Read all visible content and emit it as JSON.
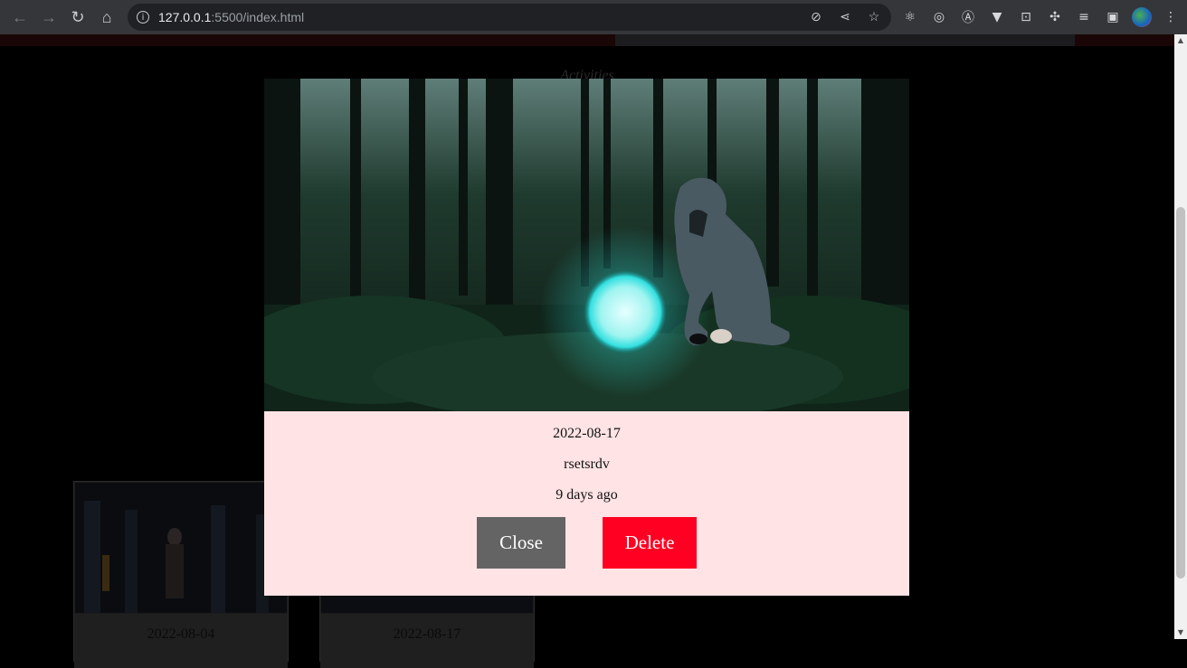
{
  "browser": {
    "url_host": "127.0.0.1",
    "url_path": ":5500/index.html"
  },
  "page": {
    "section_heading": "Activities",
    "cards": [
      {
        "date": "2022-08-04"
      },
      {
        "date": "2022-08-17"
      }
    ]
  },
  "modal": {
    "date": "2022-08-17",
    "title": "rsetsrdv",
    "relative_time": "9 days ago",
    "close_label": "Close",
    "delete_label": "Delete"
  },
  "colors": {
    "modal_bg": "#ffe3e5",
    "close_button": "#646464",
    "delete_button": "#ff0022"
  }
}
